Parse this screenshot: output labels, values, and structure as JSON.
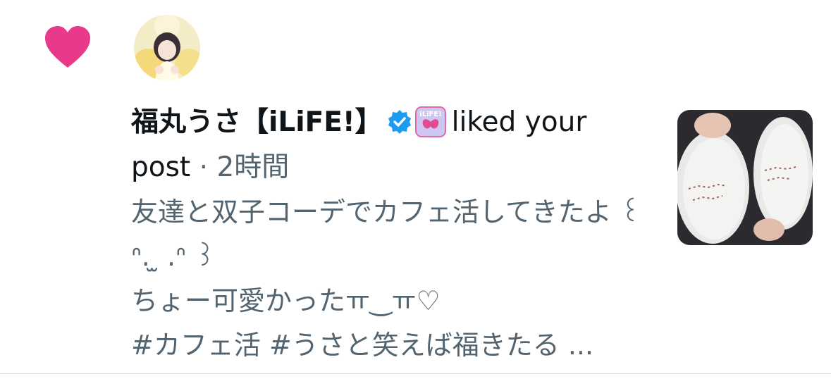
{
  "notification": {
    "icon": "heart-icon",
    "like_color": "#e8398a",
    "user_display_name": "福丸うさ【iLiFE!】",
    "verified_icon": "verified-badge-icon",
    "verified_color": "#1d9bf0",
    "group_badge_icon": "ilife-logo-icon",
    "action_text": "liked your post",
    "separator": "·",
    "time_ago": "2時間",
    "post_text": {
      "line1": "友達と双子コーデでカフェ活してきたよ ꒰ ᐢ. ̫ .ᐢ ꒱",
      "line2": "ちょー可愛かったㅠ‿ㅠ♡",
      "line3": "#カフェ活 #うさと笑えば福きたる ..."
    },
    "thumbnail_icon": "post-thumbnail-image"
  }
}
